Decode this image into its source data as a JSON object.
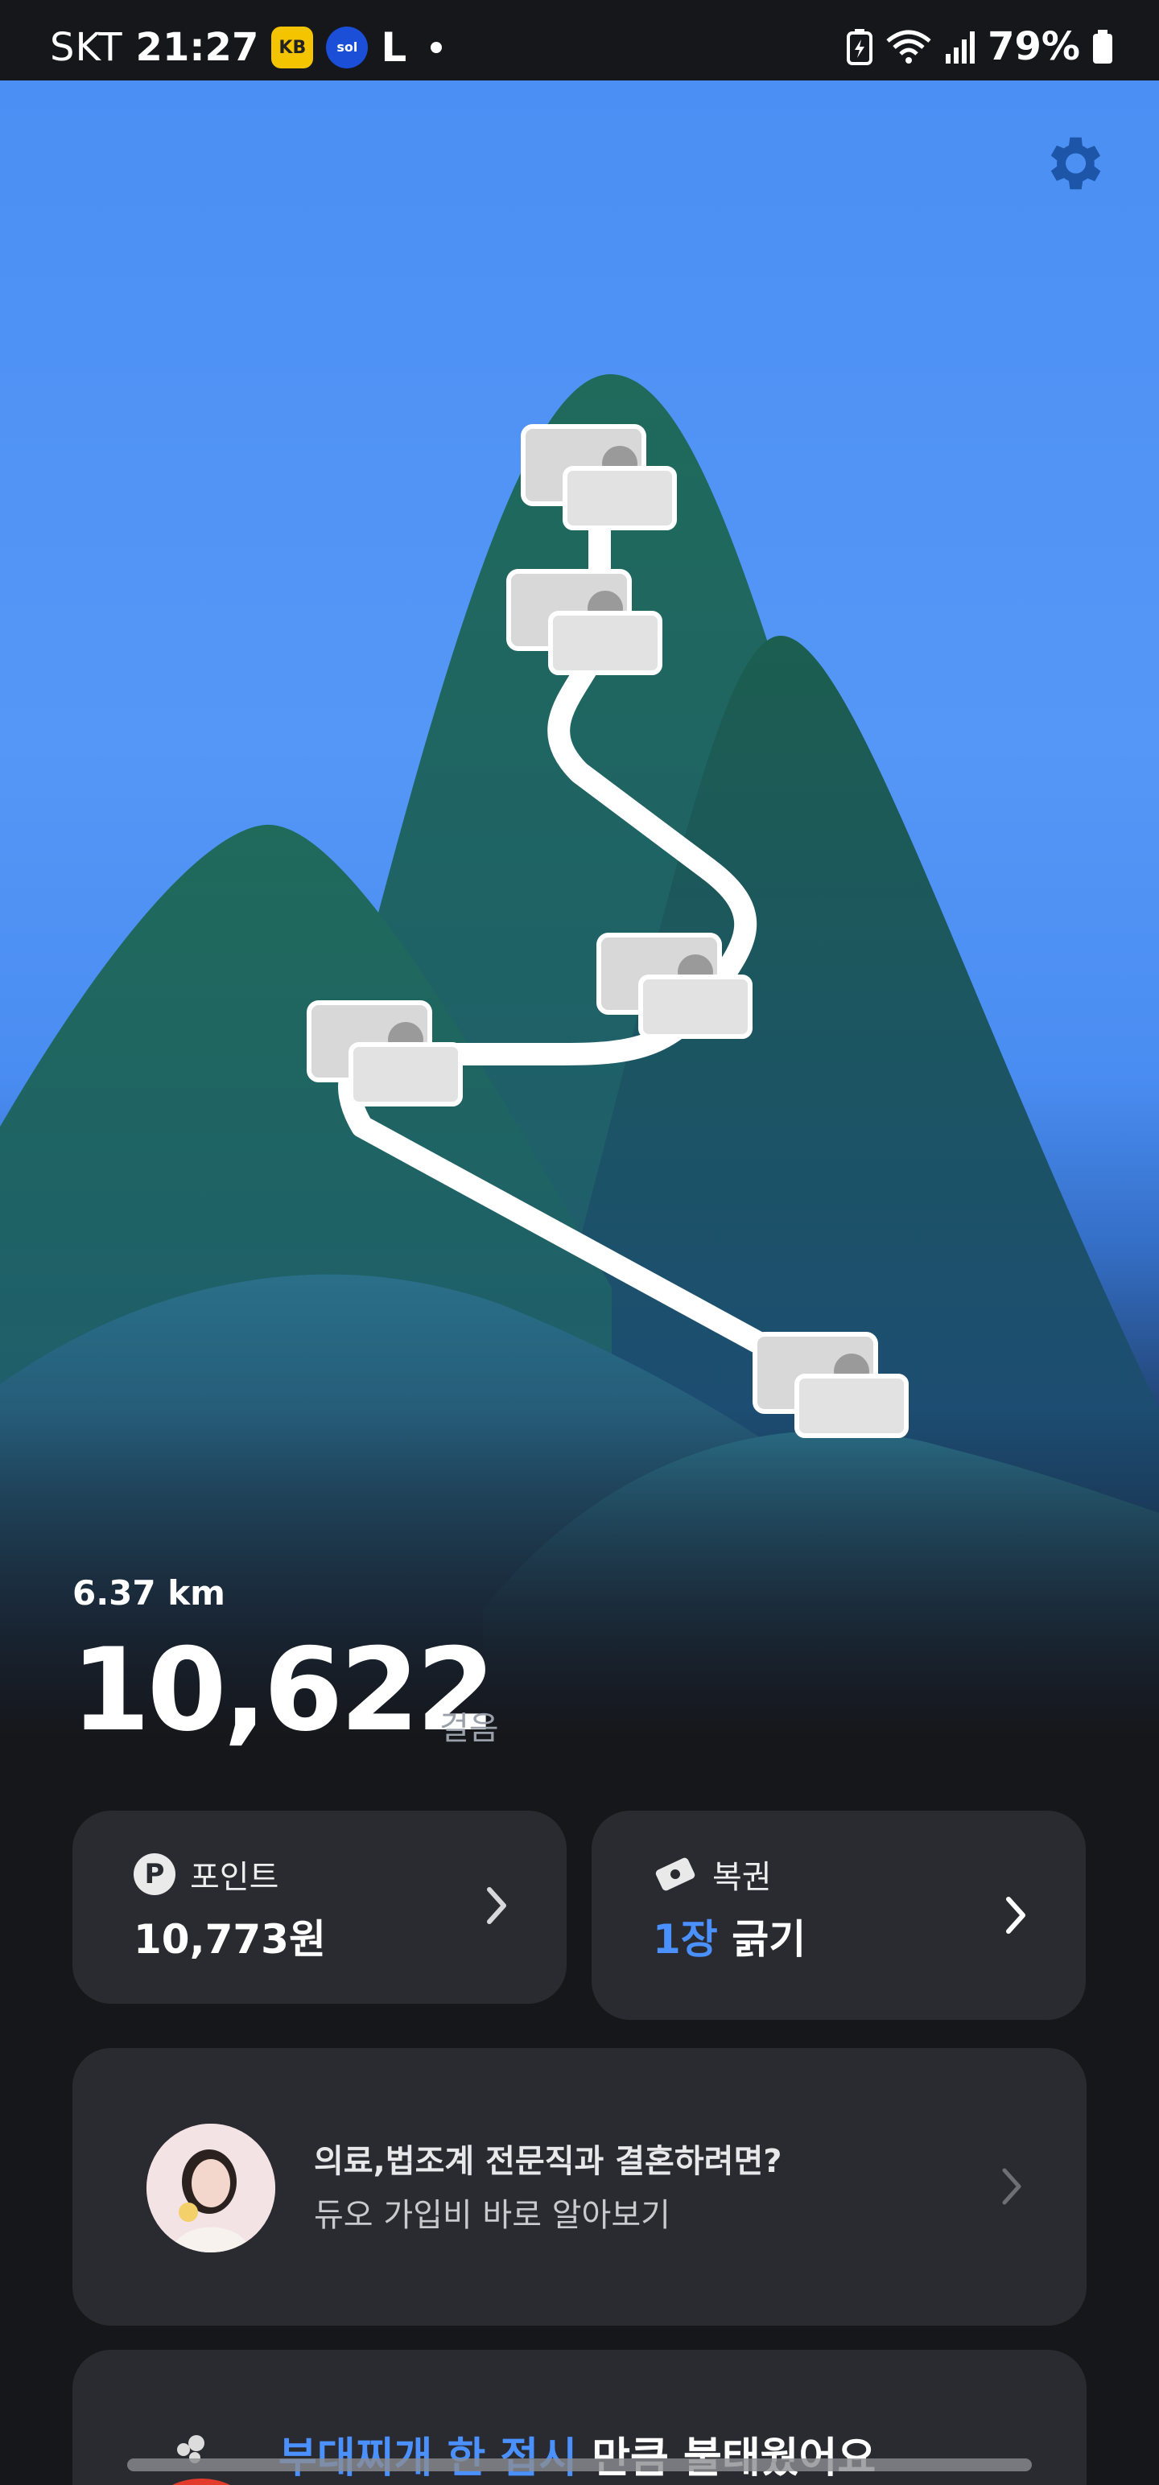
{
  "status_bar": {
    "carrier": "SKT",
    "time": "21:27",
    "battery": "79%"
  },
  "hero": {
    "distance": "6.37 km",
    "steps": "10,622",
    "steps_unit": "걸음"
  },
  "points_card": {
    "label": "포인트",
    "value": "10,773원",
    "icon_letter": "P"
  },
  "lotto_card": {
    "label": "복권",
    "count": "1장",
    "action": "긁기"
  },
  "ad_card": {
    "title": "의료,법조계 전문직과 결혼하려면?",
    "subtitle": "듀오 가입비 바로 알아보기"
  },
  "burn_card": {
    "highlight": "부대찌개 한 접시",
    "rest": " 만큼 불태웠어요"
  },
  "colors": {
    "sky": "#4b8ff4",
    "mountain": "#1f6b5a",
    "card": "#2a2b31",
    "accent": "#4a90ff"
  }
}
